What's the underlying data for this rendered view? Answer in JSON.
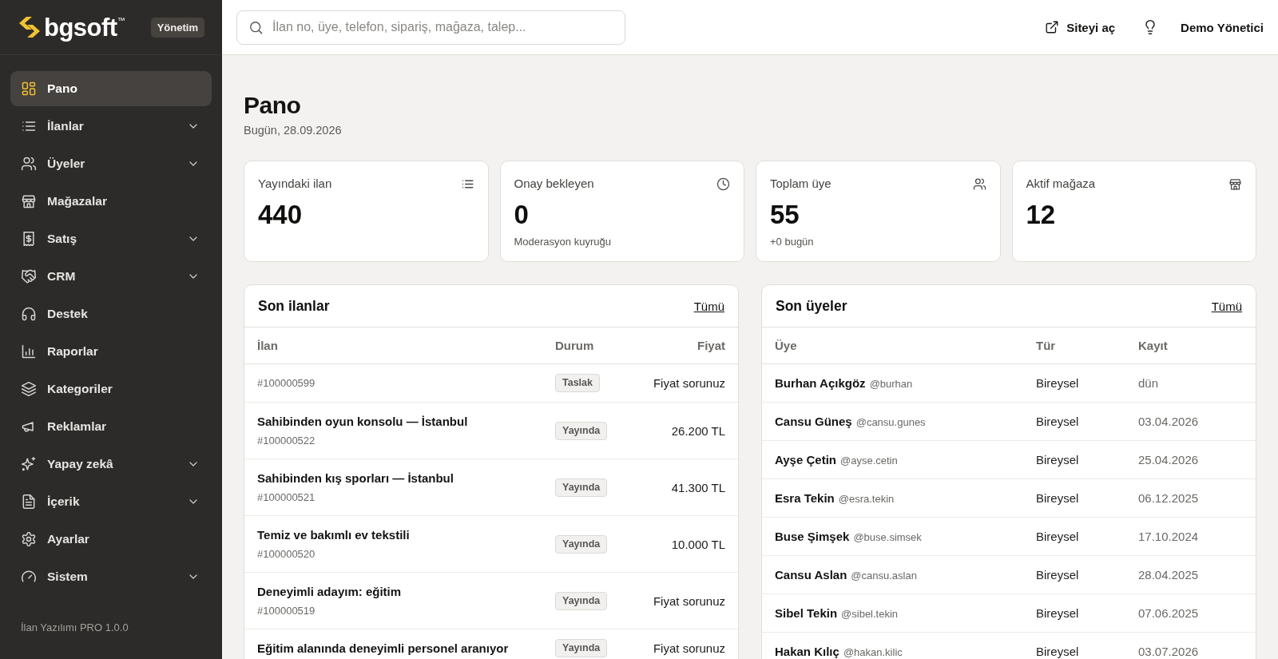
{
  "sidebar": {
    "logo": {
      "text": "bgsoft",
      "trademark": "™"
    },
    "badge": "Yönetim",
    "items": [
      {
        "label": "Pano",
        "selected": true,
        "expandable": false
      },
      {
        "label": "İlanlar",
        "selected": false,
        "expandable": true
      },
      {
        "label": "Üyeler",
        "selected": false,
        "expandable": true
      },
      {
        "label": "Mağazalar",
        "selected": false,
        "expandable": false
      },
      {
        "label": "Satış",
        "selected": false,
        "expandable": true
      },
      {
        "label": "CRM",
        "selected": false,
        "expandable": true
      },
      {
        "label": "Destek",
        "selected": false,
        "expandable": false
      },
      {
        "label": "Raporlar",
        "selected": false,
        "expandable": false
      },
      {
        "label": "Kategoriler",
        "selected": false,
        "expandable": false
      },
      {
        "label": "Reklamlar",
        "selected": false,
        "expandable": false
      },
      {
        "label": "Yapay zekâ",
        "selected": false,
        "expandable": true
      },
      {
        "label": "İçerik",
        "selected": false,
        "expandable": true
      },
      {
        "label": "Ayarlar",
        "selected": false,
        "expandable": false
      },
      {
        "label": "Sistem",
        "selected": false,
        "expandable": true
      }
    ],
    "footer": "İlan Yazılımı PRO 1.0.0"
  },
  "header": {
    "search": {
      "placeholder": "İlan no, üye, telefon, sipariş, mağaza, talep..."
    },
    "open_site": "Siteyi aç",
    "user": "Demo Yönetici"
  },
  "page": {
    "title": "Pano",
    "date": "Bugün, 28.09.2026"
  },
  "stats": [
    {
      "label": "Yayındaki ilan",
      "value": "440"
    },
    {
      "label": "Onay bekleyen",
      "value": "0",
      "note": "Moderasyon kuyruğu"
    },
    {
      "label": "Toplam üye",
      "value": "55",
      "note": "+0 bugün"
    },
    {
      "label": "Aktif mağaza",
      "value": "12"
    }
  ],
  "listings": {
    "title": "Son ilanlar",
    "link": "Tümü",
    "columns": [
      "İlan",
      "Durum",
      "Fiyat"
    ],
    "rows": [
      {
        "id": "#100000599",
        "status": "Taslak",
        "price": "Fiyat sorunuz"
      },
      {
        "title": "Sahibinden oyun konsolu — İstanbul",
        "id": "#100000522",
        "status": "Yayında",
        "price": "26.200 TL"
      },
      {
        "title": "Sahibinden kış sporları — İstanbul",
        "id": "#100000521",
        "status": "Yayında",
        "price": "41.300 TL"
      },
      {
        "title": "Temiz ve bakımlı ev tekstili",
        "id": "#100000520",
        "status": "Yayında",
        "price": "10.000 TL"
      },
      {
        "title": "Deneyimli adayım: eğitim",
        "id": "#100000519",
        "status": "Yayında",
        "price": "Fiyat sorunuz"
      },
      {
        "title": "Eğitim alanında deneyimli personel aranıyor",
        "status": "Yayında",
        "price": "Fiyat sorunuz"
      }
    ]
  },
  "members": {
    "title": "Son üyeler",
    "link": "Tümü",
    "columns": [
      "Üye",
      "Tür",
      "Kayıt"
    ],
    "rows": [
      {
        "name": "Burhan Açıkgöz",
        "username": "@burhan",
        "type": "Bireysel",
        "date": "dün"
      },
      {
        "name": "Cansu Güneş",
        "username": "@cansu.gunes",
        "type": "Bireysel",
        "date": "03.04.2026"
      },
      {
        "name": "Ayşe Çetin",
        "username": "@ayse.cetin",
        "type": "Bireysel",
        "date": "25.04.2026"
      },
      {
        "name": "Esra Tekin",
        "username": "@esra.tekin",
        "type": "Bireysel",
        "date": "06.12.2025"
      },
      {
        "name": "Buse Şimşek",
        "username": "@buse.simsek",
        "type": "Bireysel",
        "date": "17.10.2024"
      },
      {
        "name": "Cansu Aslan",
        "username": "@cansu.aslan",
        "type": "Bireysel",
        "date": "28.04.2025"
      },
      {
        "name": "Sibel Tekin",
        "username": "@sibel.tekin",
        "type": "Bireysel",
        "date": "07.06.2025"
      },
      {
        "name": "Hakan Kılıç",
        "username": "@hakan.kilic",
        "type": "Bireysel",
        "date": "03.07.2026"
      }
    ]
  }
}
